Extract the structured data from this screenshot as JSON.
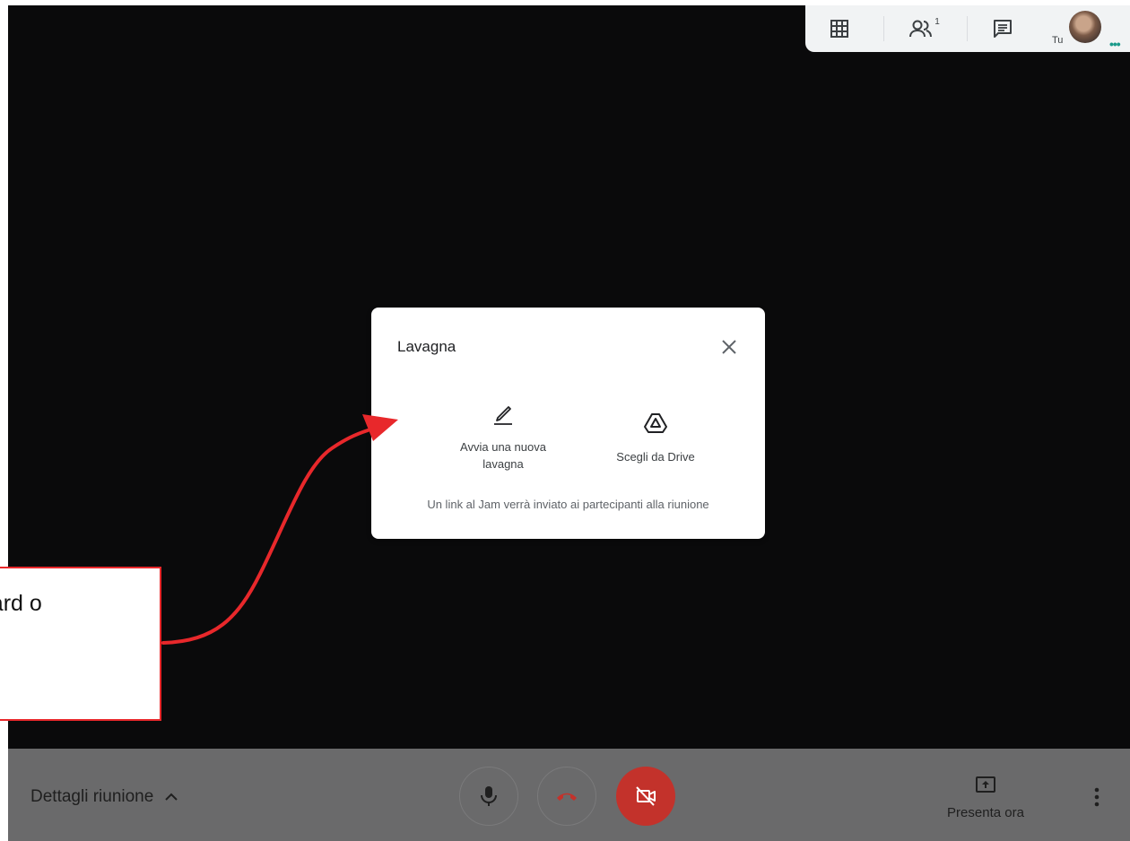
{
  "topbar": {
    "you_label": "Tu",
    "participants_count": "1",
    "buttons": [
      "grid-view-icon",
      "people-icon",
      "chat-icon"
    ]
  },
  "dialog": {
    "title": "Lavagna",
    "options": [
      {
        "label": "Avvia una nuova lavagna",
        "icon": "pencil-icon"
      },
      {
        "label": "Scegli da Drive",
        "icon": "drive-icon"
      }
    ],
    "note": "Un link al Jam verrà inviato ai partecipanti alla riunione"
  },
  "bottombar": {
    "meeting_details": "Dettagli riunione",
    "present_label": "Presenta ora"
  },
  "callout": {
    "text": "board o\nve"
  },
  "colors": {
    "background": "#0a0a0b",
    "bottombar": "#6a6a6b",
    "end_call_red": "#c3322b",
    "annotation_red": "#e8282b"
  }
}
